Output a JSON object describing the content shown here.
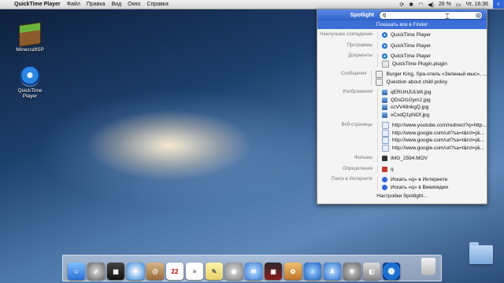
{
  "menubar": {
    "app_name": "QuickTime Player",
    "menus": [
      "Файл",
      "Правка",
      "Вид",
      "Окно",
      "Справка"
    ],
    "battery": "26 %",
    "clock": "Чт, 16:36"
  },
  "desktop": {
    "icons": [
      {
        "label": "MinecraftSP",
        "icon": "minecraft-icon"
      },
      {
        "label": "QuickTime Player",
        "icon": "quicktime-icon"
      }
    ]
  },
  "spotlight": {
    "title": "Spotlight",
    "query": "q",
    "show_all": "Показать все в Finder",
    "categories": [
      {
        "name": "Наилучшее совпадение",
        "items": [
          {
            "label": "QuickTime Player",
            "icon": "quicktime-icon"
          }
        ]
      },
      {
        "name": "Программы",
        "items": [
          {
            "label": "QuickTime Player",
            "icon": "quicktime-icon"
          }
        ]
      },
      {
        "name": "Документы",
        "items": [
          {
            "label": "QuickTime Player",
            "icon": "quicktime-icon"
          },
          {
            "label": "QuickTime Plugin.plugin",
            "icon": "document-icon"
          }
        ]
      },
      {
        "name": "Сообщения",
        "items": [
          {
            "label": "Burger King, Spa-отель «Зеленый мыс», ...",
            "icon": "mail-icon"
          },
          {
            "label": "Question about child policy",
            "icon": "mail-icon"
          }
        ]
      },
      {
        "name": "Изображения",
        "items": [
          {
            "label": "qERUHJULWt.jpg",
            "icon": "image-icon"
          },
          {
            "label": "QDsDl1Gym2.jpg",
            "icon": "image-icon"
          },
          {
            "label": "ccVV48nkgQ.jpg",
            "icon": "image-icon"
          },
          {
            "label": "vCxdQ1pNOf.jpg",
            "icon": "image-icon"
          }
        ]
      },
      {
        "name": "Веб-страницы",
        "items": [
          {
            "label": "http://www.youtube.com/redirect?q=http...",
            "icon": "web-icon"
          },
          {
            "label": "http://www.google.com/url?sa=t&rct=j&...",
            "icon": "web-icon"
          },
          {
            "label": "http://www.google.com/url?sa=t&rct=j&...",
            "icon": "web-icon"
          },
          {
            "label": "http://www.google.com/url?sa=t&rct=j&...",
            "icon": "web-icon"
          }
        ]
      },
      {
        "name": "Фильмы",
        "items": [
          {
            "label": "IMG_2594.MOV",
            "icon": "movie-icon"
          }
        ]
      },
      {
        "name": "Определения",
        "items": [
          {
            "label": "q",
            "icon": "dictionary-icon"
          }
        ]
      },
      {
        "name": "Поиск в Интернете",
        "items": [
          {
            "label": "Искать «q» в Интернете",
            "icon": "web-search-icon"
          },
          {
            "label": "Искать «q» в Википедии",
            "icon": "web-search-icon"
          }
        ]
      }
    ],
    "preferences": "Настройки Spotlight..."
  }
}
